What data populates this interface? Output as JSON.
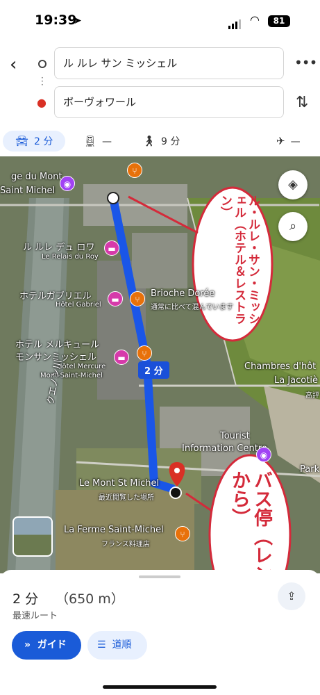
{
  "status_bar": {
    "time": "19:39",
    "battery": "81"
  },
  "route": {
    "origin": "ル ルレ サン ミッシェル",
    "destination": "ボーヴォワール"
  },
  "modes": {
    "car": "2 分",
    "transit": "—",
    "walk": "9 分",
    "flight": "—"
  },
  "map": {
    "labels": {
      "mont_top": "ge du Mont",
      "saint_michel": "Saint Michel",
      "relais": "ル ルレ デュ ロワ",
      "relais_fr": "Le Relais du Roy",
      "gabriel": "ホテルガブリエル",
      "gabriel_fr": "Hôtel Gabriel",
      "brioche": "Brioche Dorée",
      "brioche_sub": "通常に比べて混んでいます",
      "mercure": "ホテル メルキュール",
      "mercure2": "モンサンミッシェル",
      "mercure_fr": "Hôtel Mercure",
      "mercure_fr2": "Mont-Saint-Michel",
      "chambres": "Chambres d'hôt",
      "jacotiere": "La Jacotiè",
      "kodai": "高評",
      "river": "クエノン川",
      "tourist": "Tourist",
      "info": "Information Centre",
      "park": "Park",
      "mont_st_michel": "Le Mont St Michel",
      "recent": "最近閲覧した場所",
      "ferme": "La Ferme Saint-Michel",
      "ferme_sub": "フランス料理店"
    },
    "duration_tag": "2 分",
    "annotations": {
      "hotel_callout": "ル・ルレ・サン・ミッシェル（ホテル＆レストラン）",
      "bus_callout": "バス停（レンヌから）"
    }
  },
  "sheet": {
    "duration": "2 分",
    "distance": "（650 m）",
    "fastest": "最速ルート",
    "guide_button": "ガイド",
    "steps_button": "道順"
  }
}
